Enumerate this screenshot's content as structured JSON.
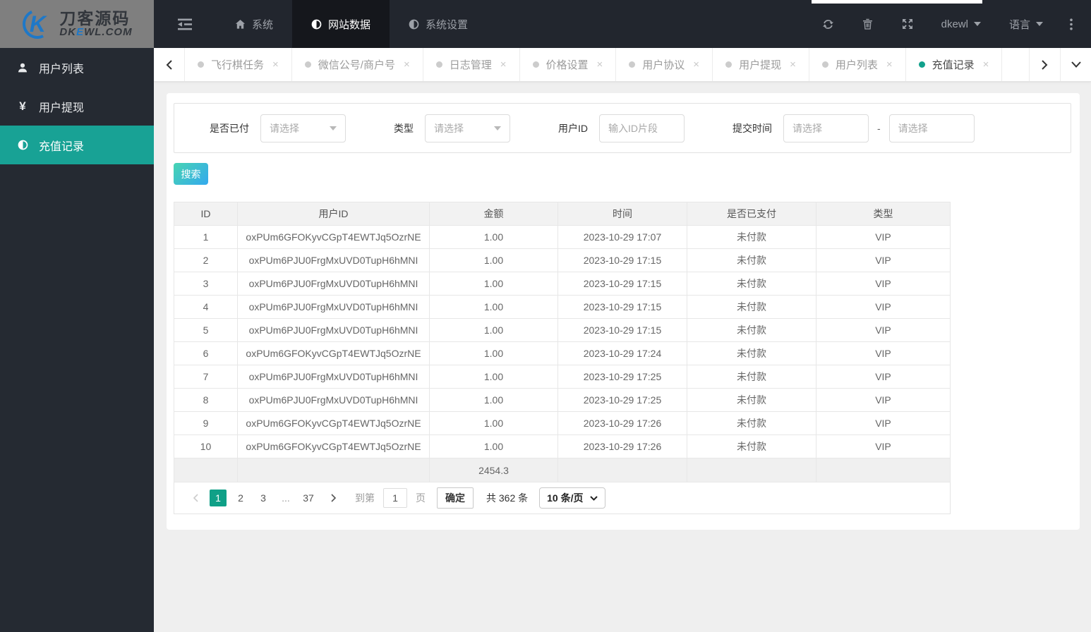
{
  "brand": {
    "name": "刀客源码",
    "domain_prefix": "DK",
    "domain_blue": "E",
    "domain_suffix": "WL.COM",
    "glyph_letter": "K"
  },
  "topnav": {
    "items": [
      {
        "key": "system",
        "label": "系统",
        "icon": "home",
        "active": false
      },
      {
        "key": "site-data",
        "label": "网站数据",
        "icon": "adjust",
        "active": true
      },
      {
        "key": "system-settings",
        "label": "系统设置",
        "icon": "adjust",
        "active": false
      }
    ],
    "username": "dkewl",
    "language_label": "语言"
  },
  "tab_bar": {
    "tabs": [
      {
        "key": "flight-chess-task",
        "label": "飞行棋任务",
        "active": false
      },
      {
        "key": "wechat-account",
        "label": "微信公号/商户号",
        "active": false
      },
      {
        "key": "log-management",
        "label": "日志管理",
        "active": false
      },
      {
        "key": "price-settings",
        "label": "价格设置",
        "active": false
      },
      {
        "key": "user-agreement",
        "label": "用户协议",
        "active": false
      },
      {
        "key": "user-withdraw",
        "label": "用户提现",
        "active": false
      },
      {
        "key": "user-list",
        "label": "用户列表",
        "active": false
      },
      {
        "key": "recharge-records",
        "label": "充值记录",
        "active": true
      }
    ],
    "close_glyph": "×"
  },
  "sidebar": {
    "items": [
      {
        "key": "user-list",
        "label": "用户列表",
        "icon": "user",
        "active": false
      },
      {
        "key": "user-withdraw",
        "label": "用户提现",
        "icon": "yen",
        "active": false
      },
      {
        "key": "recharge-records",
        "label": "充值记录",
        "icon": "adjust",
        "active": true
      }
    ]
  },
  "filters": {
    "paid_status": {
      "label": "是否已付",
      "value": "请选择"
    },
    "type": {
      "label": "类型",
      "value": "请选择"
    },
    "user_id": {
      "label": "用户ID",
      "placeholder": "输入ID片段"
    },
    "submit_time": {
      "label": "提交时间",
      "start_placeholder": "请选择",
      "end_placeholder": "请选择",
      "separator": "-"
    }
  },
  "actions": {
    "search_label": "搜索"
  },
  "table": {
    "columns": [
      "ID",
      "用户ID",
      "金额",
      "时间",
      "是否已支付",
      "类型"
    ],
    "rows": [
      {
        "id": "1",
        "user_id": "oxPUm6GFOKyvCGpT4EWTJq5OzrNE",
        "amount": "1.00",
        "time": "2023-10-29 17:07",
        "paid": "未付款",
        "type": "VIP"
      },
      {
        "id": "2",
        "user_id": "oxPUm6PJU0FrgMxUVD0TupH6hMNI",
        "amount": "1.00",
        "time": "2023-10-29 17:15",
        "paid": "未付款",
        "type": "VIP"
      },
      {
        "id": "3",
        "user_id": "oxPUm6PJU0FrgMxUVD0TupH6hMNI",
        "amount": "1.00",
        "time": "2023-10-29 17:15",
        "paid": "未付款",
        "type": "VIP"
      },
      {
        "id": "4",
        "user_id": "oxPUm6PJU0FrgMxUVD0TupH6hMNI",
        "amount": "1.00",
        "time": "2023-10-29 17:15",
        "paid": "未付款",
        "type": "VIP"
      },
      {
        "id": "5",
        "user_id": "oxPUm6PJU0FrgMxUVD0TupH6hMNI",
        "amount": "1.00",
        "time": "2023-10-29 17:15",
        "paid": "未付款",
        "type": "VIP"
      },
      {
        "id": "6",
        "user_id": "oxPUm6GFOKyvCGpT4EWTJq5OzrNE",
        "amount": "1.00",
        "time": "2023-10-29 17:24",
        "paid": "未付款",
        "type": "VIP"
      },
      {
        "id": "7",
        "user_id": "oxPUm6PJU0FrgMxUVD0TupH6hMNI",
        "amount": "1.00",
        "time": "2023-10-29 17:25",
        "paid": "未付款",
        "type": "VIP"
      },
      {
        "id": "8",
        "user_id": "oxPUm6PJU0FrgMxUVD0TupH6hMNI",
        "amount": "1.00",
        "time": "2023-10-29 17:25",
        "paid": "未付款",
        "type": "VIP"
      },
      {
        "id": "9",
        "user_id": "oxPUm6GFOKyvCGpT4EWTJq5OzrNE",
        "amount": "1.00",
        "time": "2023-10-29 17:26",
        "paid": "未付款",
        "type": "VIP"
      },
      {
        "id": "10",
        "user_id": "oxPUm6GFOKyvCGpT4EWTJq5OzrNE",
        "amount": "1.00",
        "time": "2023-10-29 17:26",
        "paid": "未付款",
        "type": "VIP"
      }
    ],
    "summary_amount": "2454.3"
  },
  "pagination": {
    "pages": [
      {
        "label": "1",
        "active": true
      },
      {
        "label": "2",
        "active": false
      },
      {
        "label": "3",
        "active": false
      },
      {
        "label": "...",
        "ellipsis": true
      },
      {
        "label": "37",
        "active": false
      }
    ],
    "goto_label": "到第",
    "goto_value": "1",
    "unit_label": "页",
    "confirm_label": "确定",
    "total_label": "共 362 条",
    "page_size_label": "10 条/页"
  },
  "colors": {
    "accent_teal": "#12a18c",
    "pagination_active": "#0fa087",
    "navbar_bg": "#22262e",
    "navbar_active_bg": "#15171c",
    "sidebar_bg": "#252a32",
    "sidebar_active_bg": "#18a295",
    "logo_bg": "#7f7f7f",
    "logo_blue": "#1e78c8",
    "search_gradient_start": "#47d4b2",
    "search_gradient_end": "#34a9ee"
  }
}
